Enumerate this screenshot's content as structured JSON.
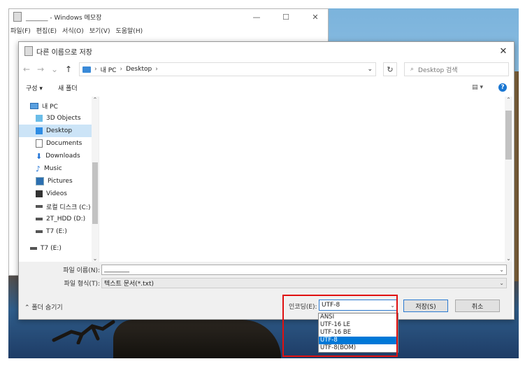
{
  "notepad": {
    "title": "_______ - Windows 메모장",
    "menu": [
      "파일(F)",
      "편집(E)",
      "서식(O)",
      "보기(V)",
      "도움말(H)"
    ],
    "controls": {
      "minimize": "—",
      "maximize": "☐",
      "close": "✕"
    }
  },
  "dialog": {
    "title": "다른 이름으로 저장",
    "close": "✕",
    "address": {
      "root": "내 PC",
      "folder": "Desktop"
    },
    "search_placeholder": "Desktop 검색",
    "toolbar": {
      "organize": "구성 ▾",
      "new_folder": "새 폴더"
    },
    "nav_items": [
      {
        "label": "내 PC",
        "icon": "pc-icon"
      },
      {
        "label": "3D Objects",
        "icon": "3d-objects-icon"
      },
      {
        "label": "Desktop",
        "icon": "desktop-icon",
        "selected": true
      },
      {
        "label": "Documents",
        "icon": "documents-icon"
      },
      {
        "label": "Downloads",
        "icon": "downloads-icon"
      },
      {
        "label": "Music",
        "icon": "music-icon"
      },
      {
        "label": "Pictures",
        "icon": "pictures-icon"
      },
      {
        "label": "Videos",
        "icon": "videos-icon"
      },
      {
        "label": "로컬 디스크 (C:)",
        "icon": "drive-icon"
      },
      {
        "label": "2T_HDD (D:)",
        "icon": "drive-icon"
      },
      {
        "label": "T7 (E:)",
        "icon": "drive-icon"
      },
      {
        "label": "T7 (E:)",
        "icon": "drive-icon"
      }
    ],
    "filename_label": "파일 이름(N):",
    "filename_value": "________",
    "filetype_label": "파일 형식(T):",
    "filetype_value": "텍스트 문서(*.txt)",
    "hide_folders": "⌃ 폴더 숨기기",
    "encoding_label": "인코딩(E):",
    "encoding_value": "UTF-8",
    "save": "저장(S)",
    "cancel": "취소",
    "encoding_options": [
      "ANSI",
      "UTF-16 LE",
      "UTF-16 BE",
      "UTF-8",
      "UTF-8(BOM)"
    ],
    "encoding_selected": "UTF-8"
  }
}
